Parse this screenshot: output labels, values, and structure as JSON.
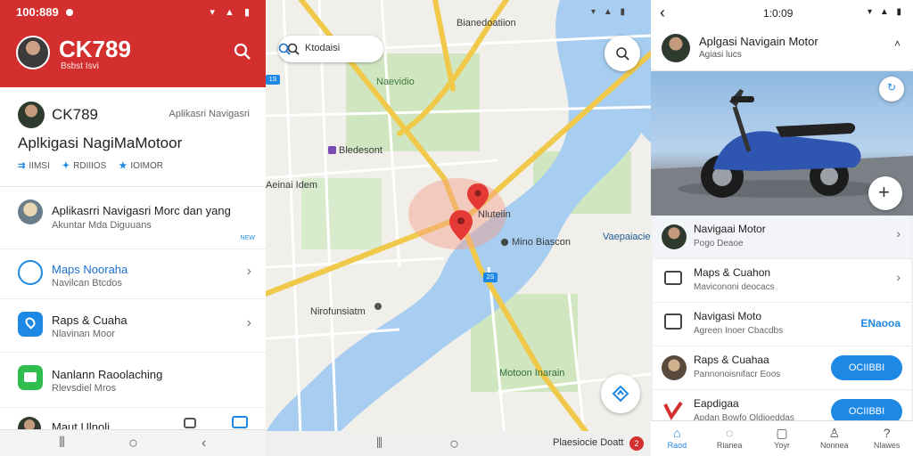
{
  "left": {
    "status_time": "100:889",
    "header_title": "CK789",
    "header_subtitle": "Bsbst Isvi",
    "card": {
      "user_name": "CK789",
      "user_side": "Aplikasri Navigasri",
      "app_title": "Aplkigasi NagiMaMotoor",
      "stats": [
        "IIMSI",
        "RDIIIOS",
        "IOIMOR"
      ]
    },
    "rows": [
      {
        "title": "Aplikasrri Navigasri Morc dan yang",
        "subtitle": "Akuntar Mda Diguuans",
        "badge": "NEW"
      },
      {
        "title": "Maps Nooraha",
        "subtitle": "Navilcan Btcdos"
      },
      {
        "title": "Raps & Cuaha",
        "subtitle": "Nlavinan Moor"
      },
      {
        "title": "Nanlann Raoolaching",
        "subtitle": "Rlevsdiel Mros"
      },
      {
        "title": "Maut Ulnoli",
        "subtitle": ""
      }
    ]
  },
  "map": {
    "search_placeholder": "Ktodaisi",
    "labels": {
      "top": "Bianedoatiion",
      "area1": "Naevidio",
      "poi1": "Bledesont",
      "area2": "Aeinai Idem",
      "pin_label": "Nluteiin",
      "poi2": "Mino Biascon",
      "right_label": "Vaepaiacie",
      "poi3": "Nirofunsiatm",
      "park": "Motoon Inarain"
    },
    "route_badges": [
      "1S",
      "2S"
    ],
    "bottom_text": "Plaesiocie Doatt",
    "bottom_badge": "2"
  },
  "right": {
    "time": "1:0:09",
    "channel_title": "Aplgasi Navigain Motor",
    "channel_subtitle": "Agiasi lucs",
    "items": [
      {
        "title": "Navigaai Motor",
        "subtitle": "Pogo Deaoe",
        "action": ""
      },
      {
        "title": "Maps & Cuahon",
        "subtitle": "Mavicononi deocacs",
        "action": ""
      },
      {
        "title": "Navigasi Moto",
        "subtitle": "Agreen Inoer Cbacdbs",
        "action": "ENaooa"
      },
      {
        "title": "Raps & Cuahaa",
        "subtitle": "Pannonoisnifacr Eoos",
        "action": "OCIIBBI"
      },
      {
        "title": "Eapdigaa",
        "subtitle": "Apdan Bowfo Oldioeddas",
        "action": "OCIIBBI"
      }
    ],
    "tabs": [
      {
        "label": "Raod",
        "icon": "home-icon",
        "active": true
      },
      {
        "label": "Rianea",
        "icon": "chat-icon",
        "active": false
      },
      {
        "label": "Yoyr",
        "icon": "square-icon",
        "active": false
      },
      {
        "label": "Nonnea",
        "icon": "user-icon",
        "active": false
      },
      {
        "label": "Nlawes",
        "icon": "help-icon",
        "active": false
      }
    ]
  },
  "colors": {
    "brand_red": "#d32f2f",
    "accent_blue": "#1e88e5",
    "route_yellow": "#f0c94a",
    "water": "#a7cdf0",
    "park": "#cfe6c0"
  }
}
